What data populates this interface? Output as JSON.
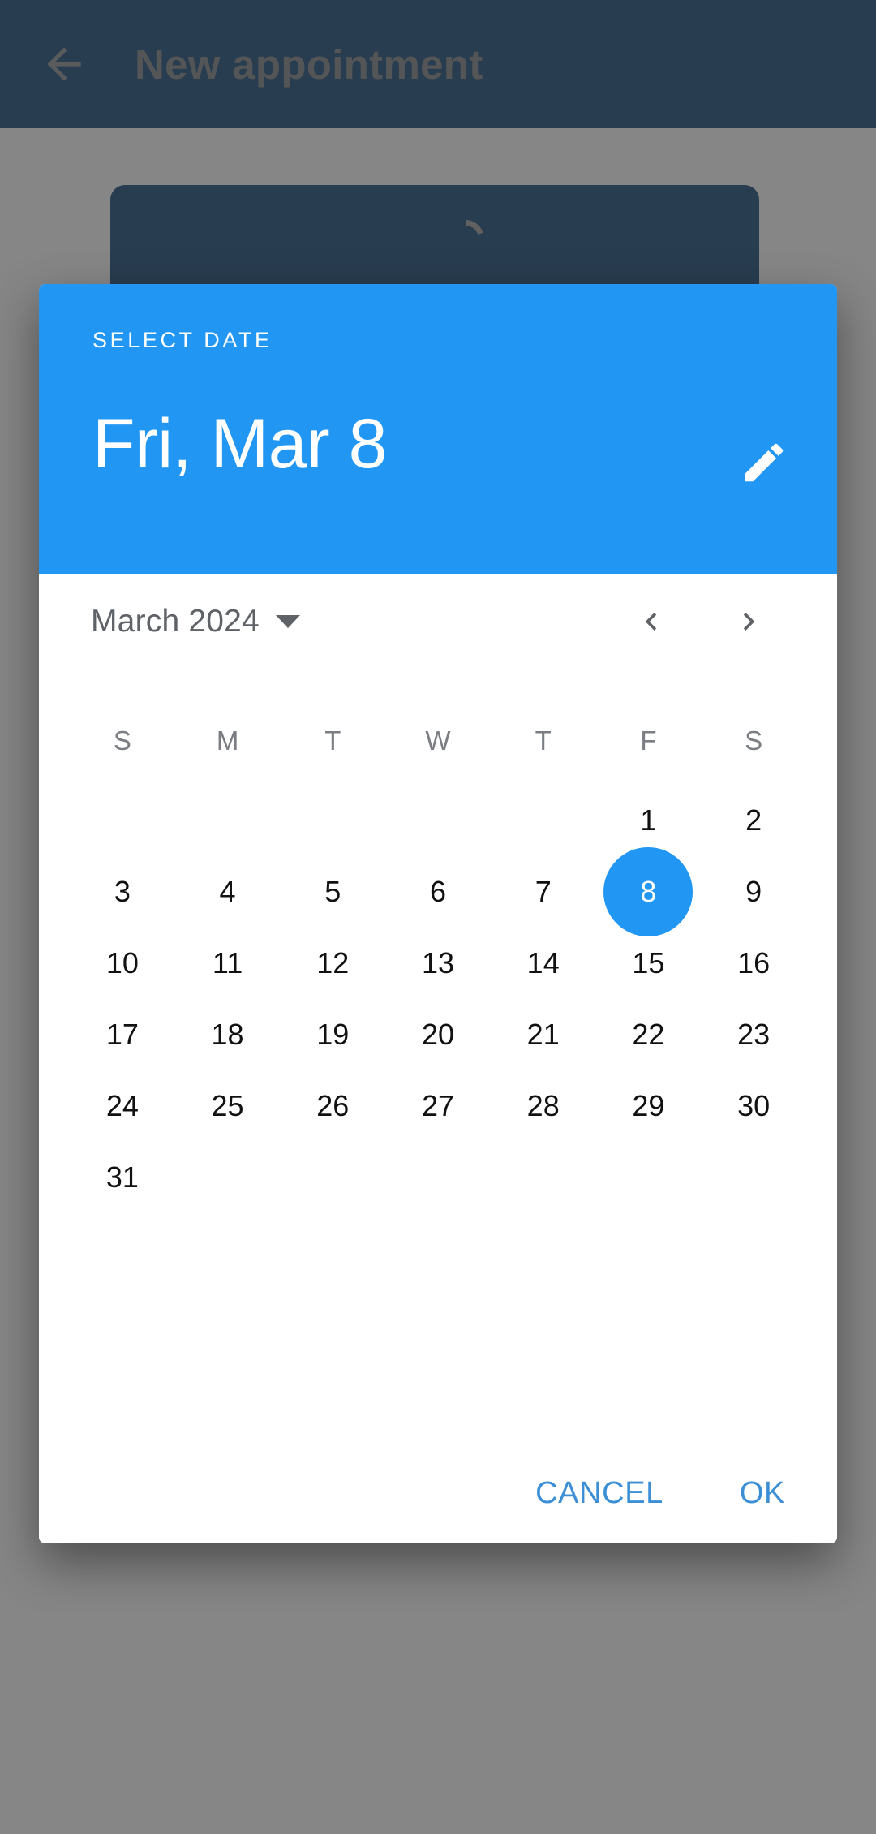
{
  "appbar": {
    "back_icon": "arrow-left-icon",
    "title": "New appointment",
    "background_color": "#0d4071",
    "title_color": "#7b7f84"
  },
  "background_card": {
    "spinner_icon": "loading-arc-icon",
    "color": "#0d4071"
  },
  "scrim": {
    "color": "#3c3c3c",
    "opacity": "0.62"
  },
  "dialog": {
    "accent_color": "#2196f3",
    "header": {
      "overline": "SELECT DATE",
      "headline": "Fri, Mar 8",
      "edit_icon": "pencil-icon"
    },
    "calendar": {
      "month_label": "March 2024",
      "dropdown_icon": "chevron-down-icon",
      "prev_icon": "chevron-left-icon",
      "next_icon": "chevron-right-icon",
      "weekdays": [
        "S",
        "M",
        "T",
        "W",
        "T",
        "F",
        "S"
      ],
      "leading_blanks": 5,
      "days": [
        1,
        2,
        3,
        4,
        5,
        6,
        7,
        8,
        9,
        10,
        11,
        12,
        13,
        14,
        15,
        16,
        17,
        18,
        19,
        20,
        21,
        22,
        23,
        24,
        25,
        26,
        27,
        28,
        29,
        30,
        31
      ],
      "selected_day": 8,
      "selected_color": "#2196f3"
    },
    "actions": {
      "cancel_label": "CANCEL",
      "ok_label": "OK",
      "color": "#3c8fd4"
    }
  }
}
